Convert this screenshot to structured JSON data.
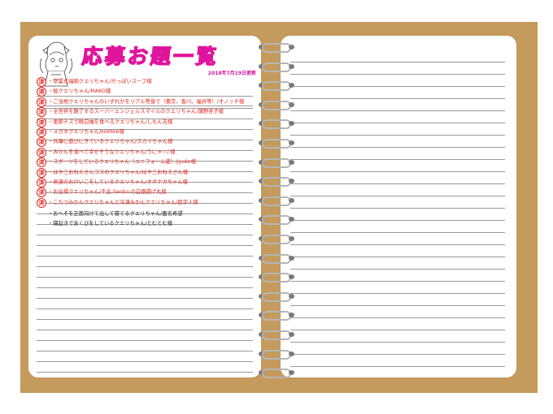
{
  "header": {
    "title": "応募お題一覧",
    "updated": "2018年7月19日更新"
  },
  "stamp_label": "済",
  "items": [
    {
      "text": "・卒業式福岡クエリちゃん/ホっぽいスープ様",
      "done": true
    },
    {
      "text": "・桜クエリちゃん/MAKO様",
      "done": true
    },
    {
      "text": "・ご当地クエリちゃんのいずれかをリアル等身で（東京、香川、福井等）/オノッチ様",
      "done": true
    },
    {
      "text": "・全世界を魅了するスーパーエンジェルスマイルのクエリちゃん/蒲野杏子様",
      "done": true
    },
    {
      "text": "・恵節チズで晩白柚を食べるクエリちゃん/しもん吉様",
      "done": true
    },
    {
      "text": "・メガネクエリちゃん/kok6k6様",
      "done": true
    },
    {
      "text": "・兵庫に遊びにきているクエリちゃん/スカイちゃん様",
      "done": true
    },
    {
      "text": "・みかんを食べて幸せそうなクエリちゃん/うにゃ☆♪様",
      "done": true
    },
    {
      "text": "・スポーツをしているクエリちゃん（ユニフォーム姿）/jyuko様",
      "done": true
    },
    {
      "text": "・ほや三おねえさんコスのクエリちゃん/ほや三おねえさん様",
      "done": true
    },
    {
      "text": "・剣道のおけいこをしているクエリちゃん/オボナカちゃん様",
      "done": true
    },
    {
      "text": "・お台場クエリちゃん/千古-Senko-の白銀揚げ丸様",
      "done": true
    },
    {
      "text": "・こたつみかんクエリちゃんと冷凍みかんクエリちゃん/民宇人様",
      "done": true
    },
    {
      "text": "・おへそを正面向けて出して寝てるクエリちゃん/匿名希望",
      "done": false
    },
    {
      "text": "・寝起きであくびをしているクエリちゃん/とむとむ様",
      "done": false
    }
  ],
  "colors": {
    "cover": "#c59a5d",
    "accent": "#e0149c",
    "done_text": "#e2231a"
  },
  "icons": {
    "mascot": "anime-girl-illustration",
    "spiral": "ring-binder-icon"
  }
}
